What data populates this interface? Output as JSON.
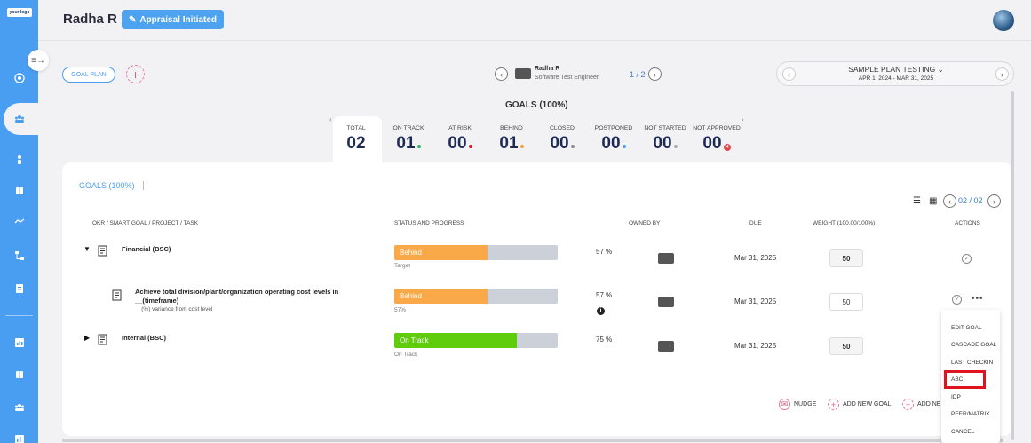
{
  "brand": {
    "logo_text": "your logo"
  },
  "header": {
    "employee_name": "Radha R",
    "status_badge": "Appraisal Initiated"
  },
  "plan_bar": {
    "goal_plan_label": "GOAL PLAN",
    "employee": {
      "name": "Radha R",
      "role": "Software Test Engineer"
    },
    "pager": "1 / 2",
    "plan_name": "SAMPLE PLAN TESTING",
    "plan_dates": "APR 1, 2024 - MAR 31, 2025"
  },
  "summary": {
    "title": "GOALS (100%)",
    "stats": [
      {
        "label": "TOTAL",
        "value": "02",
        "dot": ""
      },
      {
        "label": "ON TRACK",
        "value": "01",
        "dot": "#2bb35c"
      },
      {
        "label": "AT RISK",
        "value": "00",
        "dot": "#e0141e"
      },
      {
        "label": "BEHIND",
        "value": "01",
        "dot": "#f0a22a"
      },
      {
        "label": "CLOSED",
        "value": "00",
        "dot": "#888888"
      },
      {
        "label": "POSTPONED",
        "value": "00",
        "dot": "#4a9ef2"
      },
      {
        "label": "NOT STARTED",
        "value": "00",
        "dot": "#aaaaaa"
      },
      {
        "label": "NOT APPROVED",
        "value": "00",
        "dot": "#e0474c"
      }
    ]
  },
  "goals_card": {
    "title": "GOALS (100%)",
    "pager": "02 / 02",
    "columns": [
      "OKR / SMART GOAL / PROJECT / TASK",
      "STATUS AND PROGRESS",
      "OWNED BY",
      "DUE",
      "WEIGHT (100.00/100%)",
      "ACTIONS"
    ],
    "rows": [
      {
        "title": "Financial (BSC)",
        "subtitle": "",
        "status": "Behind",
        "progress_pct": 57,
        "pct_label": "57 %",
        "bar_sub": "Target",
        "due": "Mar 31, 2025",
        "weight": "50",
        "color": "#f9a947"
      },
      {
        "title": "Achieve total division/plant/organization operating cost levels in __(timeframe)",
        "title_line1": "Achieve total division/plant/organization operating cost levels in",
        "title_line2": "__(timeframe)",
        "subtitle": "__(%) variance from cost level",
        "status": "Behind",
        "progress_pct": 57,
        "pct_label": "57 %",
        "bar_sub": "57%",
        "due": "Mar 31, 2025",
        "weight": "50",
        "color": "#f9a947"
      },
      {
        "title": "Internal (BSC)",
        "subtitle": "",
        "status": "On Track",
        "progress_pct": 75,
        "pct_label": "75 %",
        "bar_sub": "On Track",
        "due": "Mar 31, 2025",
        "weight": "50",
        "color": "#5fcc0c"
      }
    ],
    "footer_actions": [
      "NUDGE",
      "ADD NEW GOAL",
      "ADD NE"
    ]
  },
  "actions_menu": {
    "items": [
      "EDIT GOAL",
      "CASCADE GOAL",
      "LAST CHECKIN",
      "ABC",
      "IDP",
      "PEER/MATRIX",
      "CANCEL"
    ],
    "highlighted": "ABC"
  }
}
